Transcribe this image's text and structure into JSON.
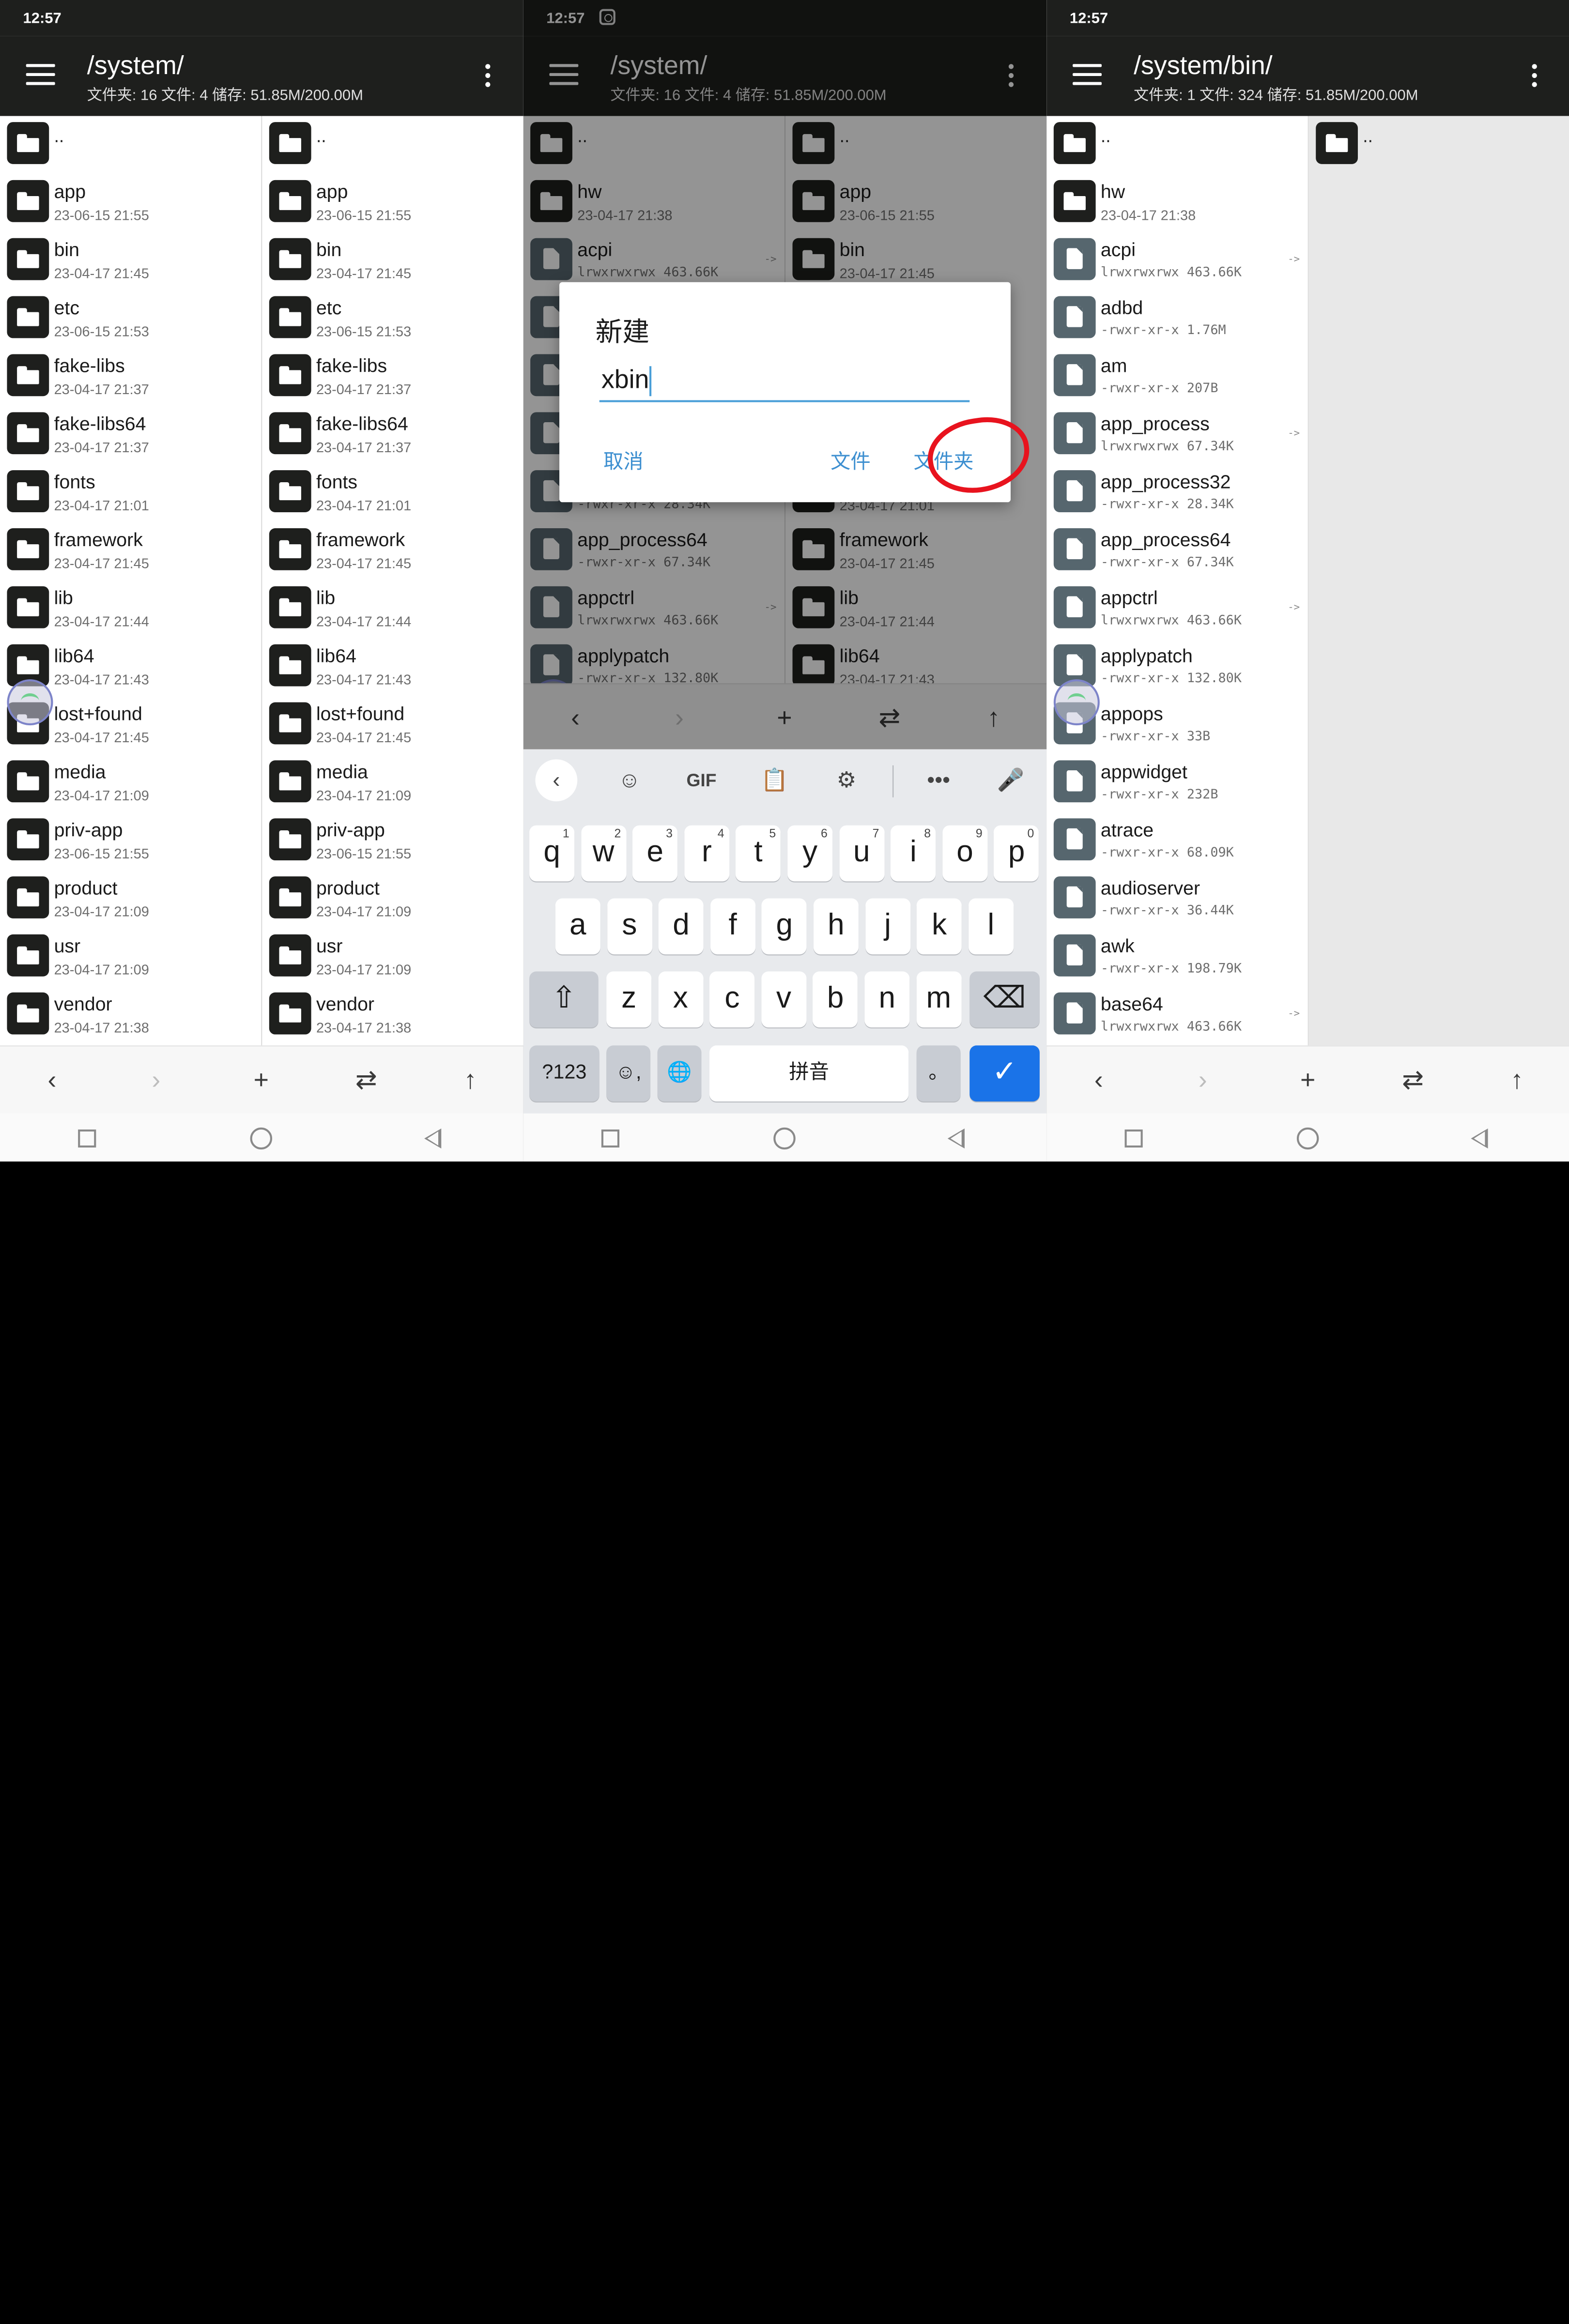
{
  "status_time": "12:57",
  "left_screen": {
    "path": "/system/",
    "summary": "文件夹: 16  文件: 4  储存: 51.85M/200.00M",
    "up_label": "..",
    "left_pane": [
      {
        "name": "app",
        "sub": "23-06-15 21:55"
      },
      {
        "name": "bin",
        "sub": "23-04-17 21:45"
      },
      {
        "name": "etc",
        "sub": "23-06-15 21:53"
      },
      {
        "name": "fake-libs",
        "sub": "23-04-17 21:37"
      },
      {
        "name": "fake-libs64",
        "sub": "23-04-17 21:37"
      },
      {
        "name": "fonts",
        "sub": "23-04-17 21:01"
      },
      {
        "name": "framework",
        "sub": "23-04-17 21:45"
      },
      {
        "name": "lib",
        "sub": "23-04-17 21:44"
      },
      {
        "name": "lib64",
        "sub": "23-04-17 21:43"
      },
      {
        "name": "lost+found",
        "sub": "23-04-17 21:45"
      },
      {
        "name": "media",
        "sub": "23-04-17 21:09"
      },
      {
        "name": "priv-app",
        "sub": "23-06-15 21:55"
      },
      {
        "name": "product",
        "sub": "23-04-17 21:09"
      },
      {
        "name": "usr",
        "sub": "23-04-17 21:09"
      },
      {
        "name": "vendor",
        "sub": "23-04-17 21:38"
      }
    ],
    "right_pane": [
      {
        "name": "app",
        "sub": "23-06-15 21:55"
      },
      {
        "name": "bin",
        "sub": "23-04-17 21:45"
      },
      {
        "name": "etc",
        "sub": "23-06-15 21:53"
      },
      {
        "name": "fake-libs",
        "sub": "23-04-17 21:37"
      },
      {
        "name": "fake-libs64",
        "sub": "23-04-17 21:37"
      },
      {
        "name": "fonts",
        "sub": "23-04-17 21:01"
      },
      {
        "name": "framework",
        "sub": "23-04-17 21:45"
      },
      {
        "name": "lib",
        "sub": "23-04-17 21:44"
      },
      {
        "name": "lib64",
        "sub": "23-04-17 21:43"
      },
      {
        "name": "lost+found",
        "sub": "23-04-17 21:45"
      },
      {
        "name": "media",
        "sub": "23-04-17 21:09"
      },
      {
        "name": "priv-app",
        "sub": "23-06-15 21:55"
      },
      {
        "name": "product",
        "sub": "23-04-17 21:09"
      },
      {
        "name": "usr",
        "sub": "23-04-17 21:09"
      },
      {
        "name": "vendor",
        "sub": "23-04-17 21:38"
      }
    ]
  },
  "middle_screen": {
    "path": "/system/",
    "summary": "文件夹: 16  文件: 4  储存: 51.85M/200.00M",
    "up_label": "..",
    "left_pane": [
      {
        "name": "hw",
        "sub": "23-04-17 21:38",
        "kind": "folder"
      },
      {
        "name": "acpi",
        "sub": "lrwxrwxrwx 463.66K",
        "kind": "file",
        "link": "->"
      },
      {
        "name": "",
        "sub": "",
        "kind": "file"
      },
      {
        "name": "",
        "sub": "",
        "kind": "file"
      },
      {
        "name": "",
        "sub": "",
        "kind": "file"
      },
      {
        "name": "",
        "sub": "-rwxr-xr-x 28.34K",
        "kind": "file"
      },
      {
        "name": "app_process64",
        "sub": "-rwxr-xr-x 67.34K",
        "kind": "file"
      },
      {
        "name": "appctrl",
        "sub": "lrwxrwxrwx 463.66K",
        "kind": "file",
        "link": "->"
      },
      {
        "name": "applypatch",
        "sub": "-rwxr-xr-x 132.80K",
        "kind": "file"
      }
    ],
    "right_pane": [
      {
        "name": "app",
        "sub": "23-06-15 21:55"
      },
      {
        "name": "bin",
        "sub": "23-04-17 21:45"
      },
      {
        "name": "",
        "sub": ""
      },
      {
        "name": "",
        "sub": ""
      },
      {
        "name": "",
        "sub": ""
      },
      {
        "name": "",
        "sub": "23-04-17 21:01"
      },
      {
        "name": "framework",
        "sub": "23-04-17 21:45"
      },
      {
        "name": "lib",
        "sub": "23-04-17 21:44"
      },
      {
        "name": "lib64",
        "sub": "23-04-17 21:43"
      }
    ],
    "dialog": {
      "title": "新建",
      "input_value": "xbin",
      "cancel": "取消",
      "file": "文件",
      "folder": "文件夹"
    },
    "keyboard": {
      "toolbar": [
        "‹",
        "☺",
        "GIF",
        "📋",
        "⚙",
        "•••",
        "🎤"
      ],
      "row1": [
        {
          "k": "q",
          "n": "1"
        },
        {
          "k": "w",
          "n": "2"
        },
        {
          "k": "e",
          "n": "3"
        },
        {
          "k": "r",
          "n": "4"
        },
        {
          "k": "t",
          "n": "5"
        },
        {
          "k": "y",
          "n": "6"
        },
        {
          "k": "u",
          "n": "7"
        },
        {
          "k": "i",
          "n": "8"
        },
        {
          "k": "o",
          "n": "9"
        },
        {
          "k": "p",
          "n": "0"
        }
      ],
      "row2": [
        "a",
        "s",
        "d",
        "f",
        "g",
        "h",
        "j",
        "k",
        "l"
      ],
      "row3": [
        "z",
        "x",
        "c",
        "v",
        "b",
        "n",
        "m"
      ],
      "shift": "⇧",
      "backspace": "⌫",
      "symbols": "?123",
      "emoji_comma": "☺,",
      "globe": "🌐",
      "space": "拼音",
      "period": "。",
      "enter": "✓"
    }
  },
  "right_screen": {
    "path": "/system/bin/",
    "summary": "文件夹: 1  文件: 324  储存: 51.85M/200.00M",
    "up_label": "..",
    "left_pane": [
      {
        "name": "hw",
        "sub": "23-04-17 21:38",
        "kind": "folder"
      },
      {
        "name": "acpi",
        "sub": "lrwxrwxrwx 463.66K",
        "kind": "file",
        "link": "->"
      },
      {
        "name": "adbd",
        "sub": "-rwxr-xr-x 1.76M",
        "kind": "file"
      },
      {
        "name": "am",
        "sub": "-rwxr-xr-x 207B",
        "kind": "file"
      },
      {
        "name": "app_process",
        "sub": "lrwxrwxrwx 67.34K",
        "kind": "file",
        "link": "->"
      },
      {
        "name": "app_process32",
        "sub": "-rwxr-xr-x 28.34K",
        "kind": "file"
      },
      {
        "name": "app_process64",
        "sub": "-rwxr-xr-x 67.34K",
        "kind": "file"
      },
      {
        "name": "appctrl",
        "sub": "lrwxrwxrwx 463.66K",
        "kind": "file",
        "link": "->"
      },
      {
        "name": "applypatch",
        "sub": "-rwxr-xr-x 132.80K",
        "kind": "file"
      },
      {
        "name": "appops",
        "sub": "-rwxr-xr-x 33B",
        "kind": "file"
      },
      {
        "name": "appwidget",
        "sub": "-rwxr-xr-x 232B",
        "kind": "file"
      },
      {
        "name": "atrace",
        "sub": "-rwxr-xr-x 68.09K",
        "kind": "file"
      },
      {
        "name": "audioserver",
        "sub": "-rwxr-xr-x 36.44K",
        "kind": "file"
      },
      {
        "name": "awk",
        "sub": "-rwxr-xr-x 198.79K",
        "kind": "file"
      },
      {
        "name": "base64",
        "sub": "lrwxrwxrwx 463.66K",
        "kind": "file",
        "link": "->"
      }
    ]
  },
  "bottom_actions": {
    "back": "‹",
    "forward": "›",
    "add": "+",
    "swap": "⇄",
    "up": "↑"
  }
}
